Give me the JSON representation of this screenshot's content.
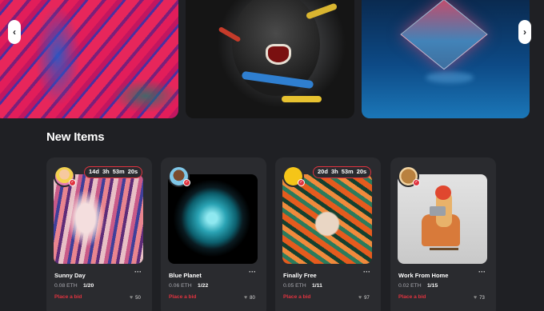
{
  "carousel": {
    "prev_icon": "chevron-left-icon",
    "next_icon": "chevron-right-icon",
    "prev_glyph": "‹",
    "next_glyph": "›"
  },
  "section": {
    "title": "New Items"
  },
  "cards": [
    {
      "name": "Sunny Day",
      "price": "0.08 ETH",
      "qty": "1/20",
      "bid": "Place a bid",
      "likes": "50",
      "timer": {
        "d": "14d",
        "h": "3h",
        "m": "53m",
        "s": "20s"
      },
      "more": "···"
    },
    {
      "name": "Blue Planet",
      "price": "0.06 ETH",
      "qty": "1/22",
      "bid": "Place a bid",
      "likes": "80",
      "more": "···"
    },
    {
      "name": "Finally Free",
      "price": "0.05 ETH",
      "qty": "1/11",
      "bid": "Place a bid",
      "likes": "97",
      "timer": {
        "d": "20d",
        "h": "3h",
        "m": "53m",
        "s": "20s"
      },
      "more": "···"
    },
    {
      "name": "Work From Home",
      "price": "0.02 ETH",
      "qty": "1/15",
      "bid": "Place a bid",
      "likes": "73",
      "more": "···"
    }
  ],
  "colors": {
    "background": "#1f2024",
    "card": "#2a2b2f",
    "accent": "#e0333f",
    "muted": "#a9aab0"
  }
}
